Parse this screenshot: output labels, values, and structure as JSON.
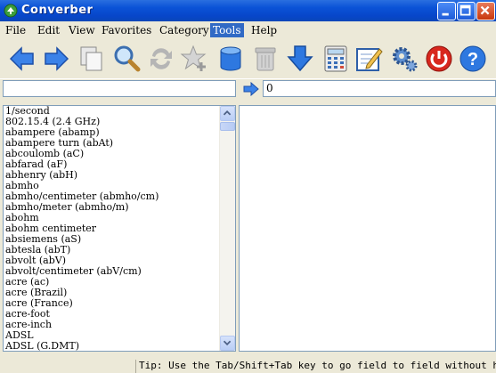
{
  "window": {
    "title": "Converber"
  },
  "menu": [
    {
      "label": "File",
      "active": false
    },
    {
      "label": "Edit",
      "active": false
    },
    {
      "label": "View",
      "active": false
    },
    {
      "label": "Favorites",
      "active": false
    },
    {
      "label": "Category",
      "active": false
    },
    {
      "label": "Tools",
      "active": true
    },
    {
      "label": "Help",
      "active": false
    }
  ],
  "toolbar": {
    "icons": [
      "back-arrow-icon",
      "forward-arrow-icon",
      "copy-icon",
      "search-icon",
      "swap-icon",
      "add-favorite-icon",
      "database-icon",
      "trash-icon",
      "download-icon",
      "calculator-icon",
      "edit-icon",
      "settings-gear-icon",
      "power-icon",
      "help-icon"
    ]
  },
  "inputs": {
    "from_value": "",
    "to_value": "0"
  },
  "units": [
    "1/second",
    "802.15.4 (2.4 GHz)",
    "abampere (abamp)",
    "abampere turn (abAt)",
    "abcoulomb (aC)",
    "abfarad (aF)",
    "abhenry (abH)",
    "abmho",
    "abmho/centimeter (abmho/cm)",
    "abmho/meter (abmho/m)",
    "abohm",
    "abohm centimeter",
    "absiemens (aS)",
    "abtesla (abT)",
    "abvolt (abV)",
    "abvolt/centimeter (abV/cm)",
    "acre (ac)",
    "acre (Brazil)",
    "acre (France)",
    "acre-foot",
    "acre-inch",
    "ADSL",
    "ADSL (G.DMT)"
  ],
  "status": {
    "tip": "Tip: Use the Tab/Shift+Tab key to go field to field without havir"
  },
  "colors": {
    "titlebar": "#0A4FD4",
    "accent": "#316AC5"
  }
}
